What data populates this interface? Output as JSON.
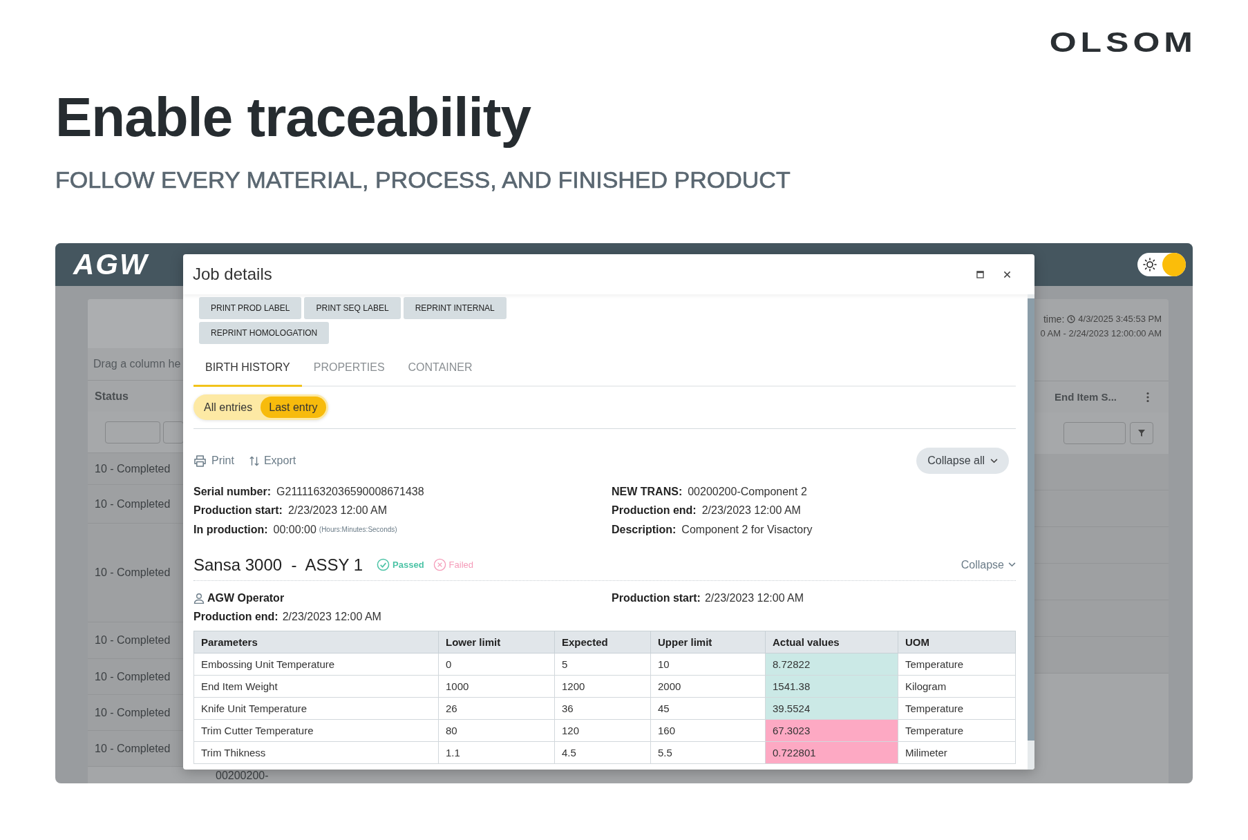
{
  "brand": {
    "logo": "OLSOM"
  },
  "hero": {
    "title": "Enable traceability",
    "subtitle": "FOLLOW EVERY MATERIAL, PROCESS, AND FINISHED PRODUCT"
  },
  "app": {
    "logo": "AGW",
    "theme_toggle": {
      "on": true
    },
    "grid": {
      "group_hint": "Drag a column he",
      "time_label": "time:",
      "time_value": "4/3/2025 3:45:53 PM",
      "range": "0 AM - 2/24/2023 12:00:00 AM",
      "columns": [
        "Status",
        "End Item S..."
      ],
      "status_rows": [
        "10 - Completed",
        "10 - Completed",
        "10 - Completed",
        "10 - Completed",
        "10 - Completed",
        "10 - Completed",
        "10 - Completed"
      ],
      "row_fragment": "00200200-"
    }
  },
  "dialog": {
    "title": "Job details",
    "actions": [
      "PRINT PROD LABEL",
      "PRINT SEQ LABEL",
      "REPRINT INTERNAL",
      "REPRINT HOMOLOGATION"
    ],
    "tabs": [
      {
        "label": "BIRTH HISTORY",
        "selected": true
      },
      {
        "label": "PROPERTIES",
        "selected": false
      },
      {
        "label": "CONTAINER",
        "selected": false
      }
    ],
    "entry_filter": [
      {
        "label": "All entries",
        "selected": false
      },
      {
        "label": "Last entry",
        "selected": true
      }
    ],
    "tools": [
      {
        "kind": "print",
        "label": "Print"
      },
      {
        "kind": "export",
        "label": "Export"
      }
    ],
    "collapse_all": "Collapse all",
    "details": [
      {
        "label": "Serial number:",
        "value": "G21111632036590008671438"
      },
      {
        "label": "NEW TRANS:",
        "value": "00200200-Component 2"
      },
      {
        "label": "Production start:",
        "value": "2/23/2023 12:00 AM"
      },
      {
        "label": "Production end:",
        "value": "2/23/2023 12:00 AM"
      },
      {
        "label": "In production:",
        "value": "00:00:00",
        "note": "(Hours:Minutes:Seconds)"
      },
      {
        "label": "Description:",
        "value": "Component 2 for Visactory"
      }
    ],
    "section": {
      "title": "Sansa 3000  -  ASSY 1",
      "statuses": [
        {
          "kind": "passed",
          "label": "Passed"
        },
        {
          "kind": "failed",
          "label": "Failed"
        }
      ],
      "collapse": "Collapse",
      "operator": "AGW Operator",
      "production_start_label": "Production start:",
      "production_start": "2/23/2023 12:00 AM",
      "production_end_label": "Production end:",
      "production_end": "2/23/2023 12:00 AM"
    },
    "table": {
      "columns": [
        "Parameters",
        "Lower limit",
        "Expected",
        "Upper limit",
        "Actual values",
        "UOM"
      ],
      "rows": [
        {
          "parameter": "Embossing Unit Temperature",
          "lower": "0",
          "expected": "5",
          "upper": "10",
          "actual": "8.72822",
          "actual_ok": true,
          "uom": "Temperature"
        },
        {
          "parameter": "End Item Weight",
          "lower": "1000",
          "expected": "1200",
          "upper": "2000",
          "actual": "1541.38",
          "actual_ok": true,
          "uom": "Kilogram"
        },
        {
          "parameter": "Knife Unit Temperature",
          "lower": "26",
          "expected": "36",
          "upper": "45",
          "actual": "39.5524",
          "actual_ok": true,
          "uom": "Temperature"
        },
        {
          "parameter": "Trim Cutter Temperature",
          "lower": "80",
          "expected": "120",
          "upper": "160",
          "actual": "67.3023",
          "actual_ok": false,
          "uom": "Temperature"
        },
        {
          "parameter": "Trim Thikness",
          "lower": "1.1",
          "expected": "4.5",
          "upper": "5.5",
          "actual": "0.722801",
          "actual_ok": false,
          "uom": "Milimeter"
        }
      ]
    }
  }
}
